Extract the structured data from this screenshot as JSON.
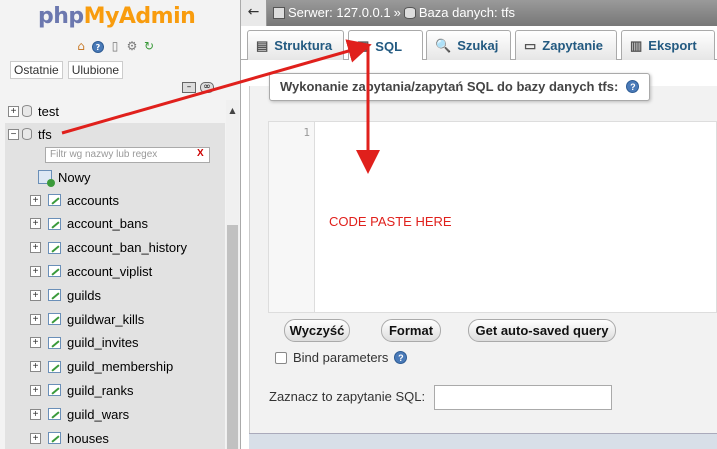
{
  "logo": {
    "part1": "php",
    "part2": "MyAdmin"
  },
  "quick_icons": [
    "home-icon",
    "help-icon",
    "docs-icon",
    "settings-icon",
    "reload-icon"
  ],
  "recent_tabs": [
    "Ostatnie",
    "Ulubione"
  ],
  "tree": {
    "databases": [
      {
        "name": "test",
        "expander": "+"
      },
      {
        "name": "tfs",
        "expander": "−"
      }
    ],
    "filter_placeholder": "Filtr wg nazwy lub regex",
    "filter_clear": "X",
    "new_label": "Nowy",
    "tables": [
      "accounts",
      "account_bans",
      "account_ban_history",
      "account_viplist",
      "guilds",
      "guildwar_kills",
      "guild_invites",
      "guild_membership",
      "guild_ranks",
      "guild_wars",
      "houses"
    ]
  },
  "breadcrumb": {
    "server": "Serwer: 127.0.0.1",
    "sep": "»",
    "database": "Baza danych: tfs"
  },
  "tabs": [
    {
      "label": "Struktura",
      "icon": "structure-icon"
    },
    {
      "label": "SQL",
      "icon": "sql-icon",
      "active": true
    },
    {
      "label": "Szukaj",
      "icon": "search-icon"
    },
    {
      "label": "Zapytanie",
      "icon": "query-icon"
    },
    {
      "label": "Eksport",
      "icon": "export-icon"
    }
  ],
  "sql": {
    "legend": "Wykonanie zapytania/zapytań SQL do bazy danych tfs:",
    "line_number": "1",
    "editor_text": "CODE PASTE HERE",
    "buttons": {
      "clear": "Wyczyść",
      "format": "Format",
      "autosaved": "Get auto-saved query"
    },
    "bind_params": "Bind parameters",
    "bookmark_label": "Zaznacz to zapytanie SQL:",
    "bookmark_value": ""
  },
  "colors": {
    "annotation_arrow": "#e0201c",
    "link": "#235a81"
  }
}
